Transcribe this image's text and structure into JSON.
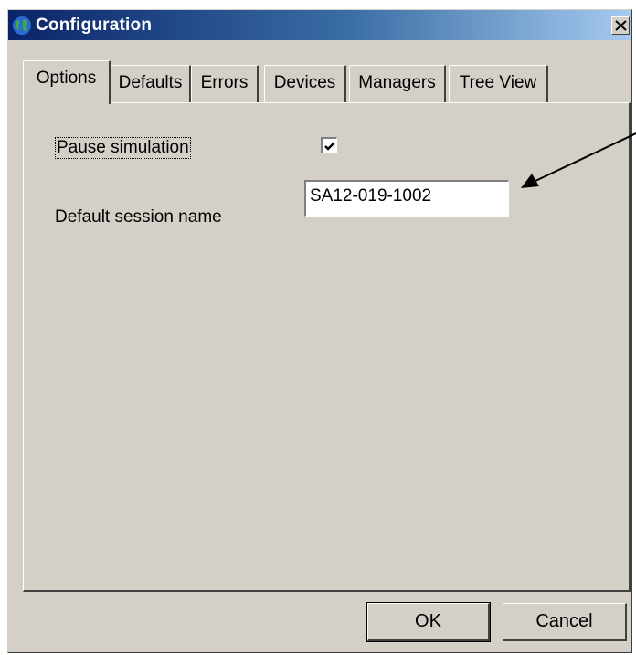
{
  "window": {
    "title": "Configuration",
    "app_icon": "globe-icon",
    "close_icon": "close-icon"
  },
  "tabs": [
    {
      "label": "Options",
      "active": true
    },
    {
      "label": "Defaults",
      "active": false
    },
    {
      "label": "Errors",
      "active": false
    },
    {
      "label": "Devices",
      "active": false
    },
    {
      "label": "Managers",
      "active": false
    },
    {
      "label": "Tree View",
      "active": false
    }
  ],
  "options": {
    "pause_label": "Pause simulation",
    "pause_checked": true,
    "session_label": "Default session name",
    "session_value": "SA12-019-1002"
  },
  "buttons": {
    "ok": "OK",
    "cancel": "Cancel"
  }
}
